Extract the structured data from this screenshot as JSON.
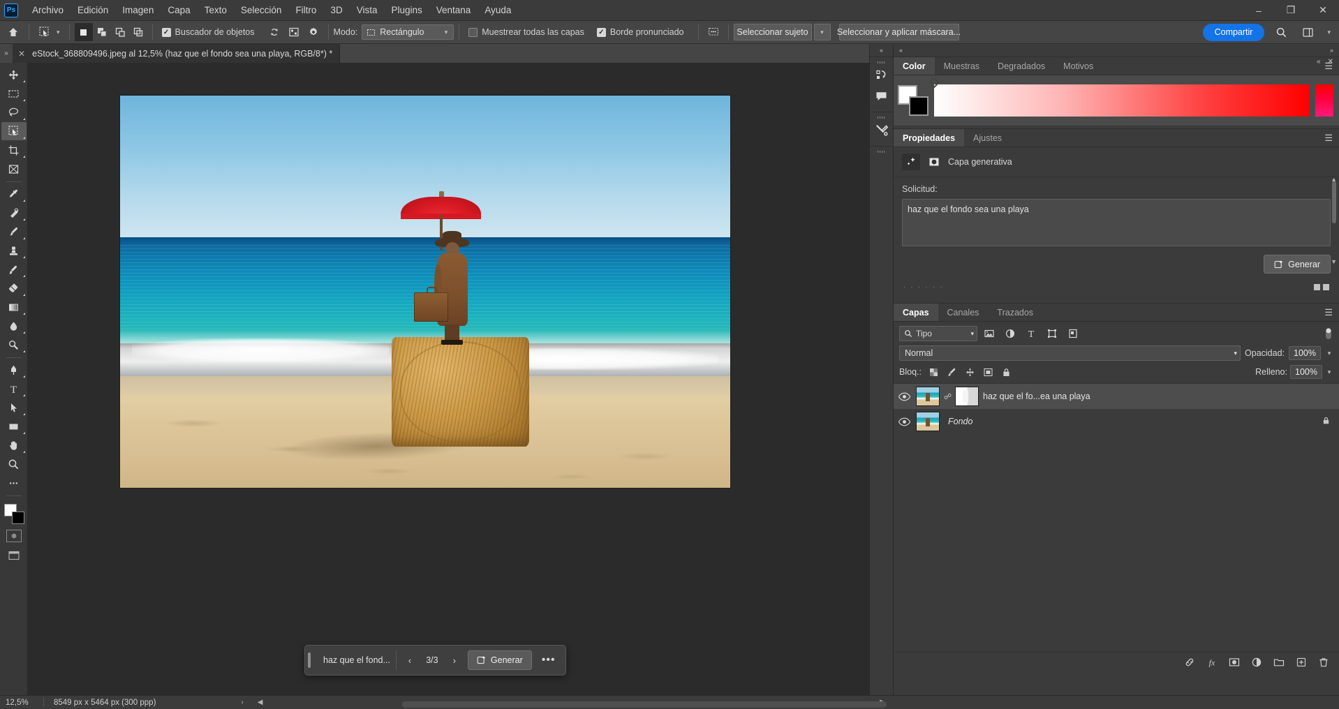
{
  "app": {
    "name": "Ps",
    "share_label": "Compartir"
  },
  "menubar": {
    "items": [
      {
        "label": "Archivo"
      },
      {
        "label": "Edición"
      },
      {
        "label": "Imagen"
      },
      {
        "label": "Capa"
      },
      {
        "label": "Texto"
      },
      {
        "label": "Selección"
      },
      {
        "label": "Filtro"
      },
      {
        "label": "3D"
      },
      {
        "label": "Vista"
      },
      {
        "label": "Plugins"
      },
      {
        "label": "Ventana"
      },
      {
        "label": "Ayuda"
      }
    ],
    "window_controls": {
      "minimize": "–",
      "maximize": "❐",
      "close": "✕"
    }
  },
  "optionsbar": {
    "object_finder_label": "Buscador de objetos",
    "object_finder_checked": true,
    "mode_label": "Modo:",
    "mode_value": "Rectángulo",
    "sample_all_layers_label": "Muestrear todas las capas",
    "sample_all_layers_checked": false,
    "enhance_edge_label": "Borde pronunciado",
    "enhance_edge_checked": true,
    "select_subject_label": "Seleccionar sujeto",
    "select_and_mask_label": "Seleccionar y aplicar máscara..."
  },
  "tabbar": {
    "doc_title": "eStock_368809496.jpeg al 12,5% (haz que el fondo sea una playa, RGB/8*) *",
    "close_glyph": "✕",
    "overflow_glyph": "»"
  },
  "genbar": {
    "prompt": "haz que el fond...",
    "prev_glyph": "‹",
    "next_glyph": "›",
    "counter": "3/3",
    "generate_label": "Generar",
    "more_glyph": "•••"
  },
  "color_panel": {
    "tabs": [
      {
        "label": "Color",
        "active": true
      },
      {
        "label": "Muestras",
        "active": false
      },
      {
        "label": "Degradados",
        "active": false
      },
      {
        "label": "Motivos",
        "active": false
      }
    ],
    "foreground_color": "#ffffff",
    "background_color": "#000000",
    "ramp_end_color": "#ff0000"
  },
  "properties_panel": {
    "tabs": [
      {
        "label": "Propiedades",
        "active": true
      },
      {
        "label": "Ajustes",
        "active": false
      }
    ],
    "layer_kind": "Capa generativa",
    "prompt_label": "Solicitud:",
    "prompt_value": "haz que el fondo sea una playa",
    "generate_label": "Generar",
    "collapse_glyph": "«",
    "close_glyph": "✕"
  },
  "layers_panel": {
    "tabs": [
      {
        "label": "Capas",
        "active": true
      },
      {
        "label": "Canales",
        "active": false
      },
      {
        "label": "Trazados",
        "active": false
      }
    ],
    "filter_label": "Tipo",
    "blend_mode": "Normal",
    "opacity_label": "Opacidad:",
    "opacity_value": "100%",
    "lock_label": "Bloq.:",
    "fill_label": "Relleno:",
    "fill_value": "100%",
    "layers": [
      {
        "name": "haz que el fo...ea una playa",
        "visible": true,
        "selected": true,
        "locked": false,
        "italic": false,
        "has_mask": true
      },
      {
        "name": "Fondo",
        "visible": true,
        "selected": false,
        "locked": true,
        "italic": true,
        "has_mask": false
      }
    ]
  },
  "statusbar": {
    "zoom": "12,5%",
    "dimensions": "8549 px x 5464 px (300 ppp)",
    "arrow_glyph": "›"
  },
  "toolbar": {
    "tools": [
      {
        "name": "move-tool",
        "active": false
      },
      {
        "name": "rectangular-marquee-tool",
        "active": false
      },
      {
        "name": "lasso-tool",
        "active": false
      },
      {
        "name": "object-selection-tool",
        "active": true
      },
      {
        "name": "crop-tool",
        "active": false
      },
      {
        "name": "frame-tool",
        "active": false
      },
      {
        "name": "eyedropper-tool",
        "active": false
      },
      {
        "name": "spot-healing-brush-tool",
        "active": false
      },
      {
        "name": "brush-tool",
        "active": false
      },
      {
        "name": "clone-stamp-tool",
        "active": false
      },
      {
        "name": "history-brush-tool",
        "active": false
      },
      {
        "name": "eraser-tool",
        "active": false
      },
      {
        "name": "gradient-tool",
        "active": false
      },
      {
        "name": "blur-tool",
        "active": false
      },
      {
        "name": "dodge-tool",
        "active": false
      },
      {
        "name": "pen-tool",
        "active": false
      },
      {
        "name": "type-tool",
        "active": false
      },
      {
        "name": "path-selection-tool",
        "active": false
      },
      {
        "name": "rectangle-tool",
        "active": false
      },
      {
        "name": "hand-tool",
        "active": false
      },
      {
        "name": "zoom-tool",
        "active": false
      },
      {
        "name": "more-tools",
        "active": false
      }
    ]
  },
  "canvas": {
    "image_description": "Mujer con abrigo marrón y sombrero sosteniendo un paraguas rojo, de pie sobre una bala de heno en una playa"
  }
}
